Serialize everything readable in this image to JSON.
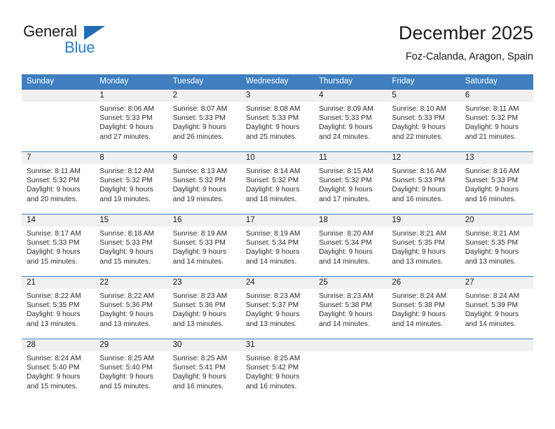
{
  "logo": {
    "text_primary": "General",
    "text_secondary": "Blue",
    "triangle_color": "#1f6db5",
    "primary_color": "#231f20",
    "secondary_color": "#2b7cc4"
  },
  "header": {
    "title": "December 2025",
    "subtitle": "Foz-Calanda, Aragon, Spain"
  },
  "colors": {
    "header_row_bg": "#3f7fbf",
    "header_row_text": "#ffffff",
    "daynum_bg": "#f0f0f0",
    "cell_text": "#2b2b2b",
    "row_divider": "#3f7fbf"
  },
  "weekday_headers": [
    "Sunday",
    "Monday",
    "Tuesday",
    "Wednesday",
    "Thursday",
    "Friday",
    "Saturday"
  ],
  "weeks": [
    [
      {
        "day": "",
        "sunrise": "",
        "sunset": "",
        "daylight_line1": "",
        "daylight_line2": ""
      },
      {
        "day": "1",
        "sunrise": "Sunrise: 8:06 AM",
        "sunset": "Sunset: 5:33 PM",
        "daylight_line1": "Daylight: 9 hours",
        "daylight_line2": "and 27 minutes."
      },
      {
        "day": "2",
        "sunrise": "Sunrise: 8:07 AM",
        "sunset": "Sunset: 5:33 PM",
        "daylight_line1": "Daylight: 9 hours",
        "daylight_line2": "and 26 minutes."
      },
      {
        "day": "3",
        "sunrise": "Sunrise: 8:08 AM",
        "sunset": "Sunset: 5:33 PM",
        "daylight_line1": "Daylight: 9 hours",
        "daylight_line2": "and 25 minutes."
      },
      {
        "day": "4",
        "sunrise": "Sunrise: 8:09 AM",
        "sunset": "Sunset: 5:33 PM",
        "daylight_line1": "Daylight: 9 hours",
        "daylight_line2": "and 24 minutes."
      },
      {
        "day": "5",
        "sunrise": "Sunrise: 8:10 AM",
        "sunset": "Sunset: 5:33 PM",
        "daylight_line1": "Daylight: 9 hours",
        "daylight_line2": "and 22 minutes."
      },
      {
        "day": "6",
        "sunrise": "Sunrise: 8:11 AM",
        "sunset": "Sunset: 5:32 PM",
        "daylight_line1": "Daylight: 9 hours",
        "daylight_line2": "and 21 minutes."
      }
    ],
    [
      {
        "day": "7",
        "sunrise": "Sunrise: 8:11 AM",
        "sunset": "Sunset: 5:32 PM",
        "daylight_line1": "Daylight: 9 hours",
        "daylight_line2": "and 20 minutes."
      },
      {
        "day": "8",
        "sunrise": "Sunrise: 8:12 AM",
        "sunset": "Sunset: 5:32 PM",
        "daylight_line1": "Daylight: 9 hours",
        "daylight_line2": "and 19 minutes."
      },
      {
        "day": "9",
        "sunrise": "Sunrise: 8:13 AM",
        "sunset": "Sunset: 5:32 PM",
        "daylight_line1": "Daylight: 9 hours",
        "daylight_line2": "and 19 minutes."
      },
      {
        "day": "10",
        "sunrise": "Sunrise: 8:14 AM",
        "sunset": "Sunset: 5:32 PM",
        "daylight_line1": "Daylight: 9 hours",
        "daylight_line2": "and 18 minutes."
      },
      {
        "day": "11",
        "sunrise": "Sunrise: 8:15 AM",
        "sunset": "Sunset: 5:32 PM",
        "daylight_line1": "Daylight: 9 hours",
        "daylight_line2": "and 17 minutes."
      },
      {
        "day": "12",
        "sunrise": "Sunrise: 8:16 AM",
        "sunset": "Sunset: 5:33 PM",
        "daylight_line1": "Daylight: 9 hours",
        "daylight_line2": "and 16 minutes."
      },
      {
        "day": "13",
        "sunrise": "Sunrise: 8:16 AM",
        "sunset": "Sunset: 5:33 PM",
        "daylight_line1": "Daylight: 9 hours",
        "daylight_line2": "and 16 minutes."
      }
    ],
    [
      {
        "day": "14",
        "sunrise": "Sunrise: 8:17 AM",
        "sunset": "Sunset: 5:33 PM",
        "daylight_line1": "Daylight: 9 hours",
        "daylight_line2": "and 15 minutes."
      },
      {
        "day": "15",
        "sunrise": "Sunrise: 8:18 AM",
        "sunset": "Sunset: 5:33 PM",
        "daylight_line1": "Daylight: 9 hours",
        "daylight_line2": "and 15 minutes."
      },
      {
        "day": "16",
        "sunrise": "Sunrise: 8:19 AM",
        "sunset": "Sunset: 5:33 PM",
        "daylight_line1": "Daylight: 9 hours",
        "daylight_line2": "and 14 minutes."
      },
      {
        "day": "17",
        "sunrise": "Sunrise: 8:19 AM",
        "sunset": "Sunset: 5:34 PM",
        "daylight_line1": "Daylight: 9 hours",
        "daylight_line2": "and 14 minutes."
      },
      {
        "day": "18",
        "sunrise": "Sunrise: 8:20 AM",
        "sunset": "Sunset: 5:34 PM",
        "daylight_line1": "Daylight: 9 hours",
        "daylight_line2": "and 14 minutes."
      },
      {
        "day": "19",
        "sunrise": "Sunrise: 8:21 AM",
        "sunset": "Sunset: 5:35 PM",
        "daylight_line1": "Daylight: 9 hours",
        "daylight_line2": "and 13 minutes."
      },
      {
        "day": "20",
        "sunrise": "Sunrise: 8:21 AM",
        "sunset": "Sunset: 5:35 PM",
        "daylight_line1": "Daylight: 9 hours",
        "daylight_line2": "and 13 minutes."
      }
    ],
    [
      {
        "day": "21",
        "sunrise": "Sunrise: 8:22 AM",
        "sunset": "Sunset: 5:35 PM",
        "daylight_line1": "Daylight: 9 hours",
        "daylight_line2": "and 13 minutes."
      },
      {
        "day": "22",
        "sunrise": "Sunrise: 8:22 AM",
        "sunset": "Sunset: 5:36 PM",
        "daylight_line1": "Daylight: 9 hours",
        "daylight_line2": "and 13 minutes."
      },
      {
        "day": "23",
        "sunrise": "Sunrise: 8:23 AM",
        "sunset": "Sunset: 5:36 PM",
        "daylight_line1": "Daylight: 9 hours",
        "daylight_line2": "and 13 minutes."
      },
      {
        "day": "24",
        "sunrise": "Sunrise: 8:23 AM",
        "sunset": "Sunset: 5:37 PM",
        "daylight_line1": "Daylight: 9 hours",
        "daylight_line2": "and 13 minutes."
      },
      {
        "day": "25",
        "sunrise": "Sunrise: 8:23 AM",
        "sunset": "Sunset: 5:38 PM",
        "daylight_line1": "Daylight: 9 hours",
        "daylight_line2": "and 14 minutes."
      },
      {
        "day": "26",
        "sunrise": "Sunrise: 8:24 AM",
        "sunset": "Sunset: 5:38 PM",
        "daylight_line1": "Daylight: 9 hours",
        "daylight_line2": "and 14 minutes."
      },
      {
        "day": "27",
        "sunrise": "Sunrise: 8:24 AM",
        "sunset": "Sunset: 5:39 PM",
        "daylight_line1": "Daylight: 9 hours",
        "daylight_line2": "and 14 minutes."
      }
    ],
    [
      {
        "day": "28",
        "sunrise": "Sunrise: 8:24 AM",
        "sunset": "Sunset: 5:40 PM",
        "daylight_line1": "Daylight: 9 hours",
        "daylight_line2": "and 15 minutes."
      },
      {
        "day": "29",
        "sunrise": "Sunrise: 8:25 AM",
        "sunset": "Sunset: 5:40 PM",
        "daylight_line1": "Daylight: 9 hours",
        "daylight_line2": "and 15 minutes."
      },
      {
        "day": "30",
        "sunrise": "Sunrise: 8:25 AM",
        "sunset": "Sunset: 5:41 PM",
        "daylight_line1": "Daylight: 9 hours",
        "daylight_line2": "and 16 minutes."
      },
      {
        "day": "31",
        "sunrise": "Sunrise: 8:25 AM",
        "sunset": "Sunset: 5:42 PM",
        "daylight_line1": "Daylight: 9 hours",
        "daylight_line2": "and 16 minutes."
      },
      {
        "day": "",
        "sunrise": "",
        "sunset": "",
        "daylight_line1": "",
        "daylight_line2": ""
      },
      {
        "day": "",
        "sunrise": "",
        "sunset": "",
        "daylight_line1": "",
        "daylight_line2": ""
      },
      {
        "day": "",
        "sunrise": "",
        "sunset": "",
        "daylight_line1": "",
        "daylight_line2": ""
      }
    ]
  ]
}
